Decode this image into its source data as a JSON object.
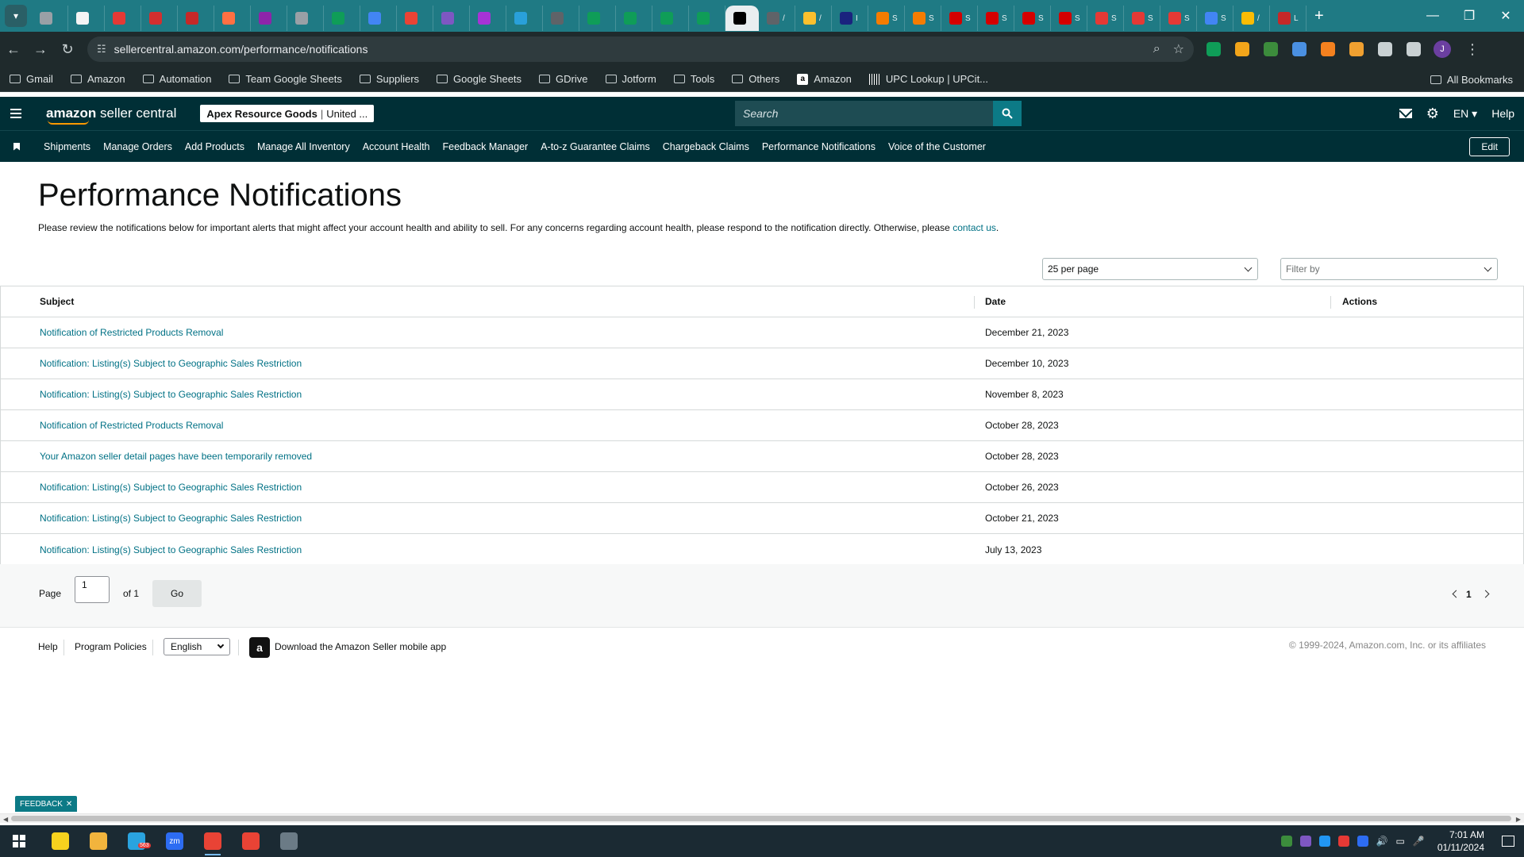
{
  "browser": {
    "tabs": [
      {
        "color": "#9aa0a6",
        "label": ""
      },
      {
        "color": "#f4f4f4",
        "label": ""
      },
      {
        "color": "#e53935",
        "label": ""
      },
      {
        "color": "#d32f2f",
        "label": ""
      },
      {
        "color": "#c62828",
        "label": ""
      },
      {
        "color": "#ff7043",
        "label": ""
      },
      {
        "color": "#8e24aa",
        "label": ""
      },
      {
        "color": "#9aa0a6",
        "label": ""
      },
      {
        "color": "#0f9d58",
        "label": ""
      },
      {
        "color": "#4285f4",
        "label": ""
      },
      {
        "color": "#ea4335",
        "label": ""
      },
      {
        "color": "#7e57c2",
        "label": ""
      },
      {
        "color": "#a633d6",
        "label": ""
      },
      {
        "color": "#29a0da",
        "label": ""
      },
      {
        "color": "#5f6368",
        "label": ""
      },
      {
        "color": "#0f9d58",
        "label": ""
      },
      {
        "color": "#0f9d58",
        "label": ""
      },
      {
        "color": "#0f9d58",
        "label": ""
      },
      {
        "color": "#0f9d58",
        "label": ""
      },
      {
        "color": "#000000",
        "label": "",
        "active": true
      },
      {
        "color": "#5f6368",
        "label": "/"
      },
      {
        "color": "#fbc02d",
        "label": "/"
      },
      {
        "color": "#1a237e",
        "label": "I"
      },
      {
        "color": "#f57c00",
        "label": "S"
      },
      {
        "color": "#f57c00",
        "label": "S"
      },
      {
        "color": "#d50000",
        "label": "S"
      },
      {
        "color": "#d50000",
        "label": "S"
      },
      {
        "color": "#d50000",
        "label": "S"
      },
      {
        "color": "#d50000",
        "label": "S"
      },
      {
        "color": "#e53935",
        "label": "S"
      },
      {
        "color": "#e53935",
        "label": "S"
      },
      {
        "color": "#e53935",
        "label": "S"
      },
      {
        "color": "#4285f4",
        "label": "S"
      },
      {
        "color": "#fbbc04",
        "label": "/"
      },
      {
        "color": "#c62828",
        "label": "L"
      }
    ],
    "new_tab_label": "+",
    "url": "sellercentral.amazon.com/performance/notifications",
    "bookmarks": [
      {
        "label": "Gmail",
        "type": "folder"
      },
      {
        "label": "Amazon",
        "type": "folder"
      },
      {
        "label": "Automation",
        "type": "folder"
      },
      {
        "label": "Team Google Sheets",
        "type": "folder"
      },
      {
        "label": "Suppliers",
        "type": "folder"
      },
      {
        "label": "Google Sheets",
        "type": "folder"
      },
      {
        "label": "GDrive",
        "type": "folder"
      },
      {
        "label": "Jotform",
        "type": "folder"
      },
      {
        "label": "Tools",
        "type": "folder"
      },
      {
        "label": "Others",
        "type": "folder"
      },
      {
        "label": "Amazon",
        "type": "amazon"
      },
      {
        "label": "UPC Lookup | UPCit...",
        "type": "upc"
      }
    ],
    "all_bookmarks": "All Bookmarks",
    "profile_initial": "J",
    "extensions": [
      "#0f9d58",
      "#f2a51a",
      "#3c8c3c",
      "#4a90e2",
      "#f4811f",
      "#f0a030",
      "#c9d1d3",
      "#c9d1d3"
    ]
  },
  "header": {
    "logo_brand": "amazon",
    "logo_product": " seller central",
    "store_name": "Apex Resource Goods",
    "store_separator": "|",
    "store_region": "United ...",
    "search_placeholder": "Search",
    "language": "EN",
    "help": "Help"
  },
  "nav": {
    "items": [
      "Shipments",
      "Manage Orders",
      "Add Products",
      "Manage All Inventory",
      "Account Health",
      "Feedback Manager",
      "A-to-z Guarantee Claims",
      "Chargeback Claims",
      "Performance Notifications",
      "Voice of the Customer"
    ],
    "edit": "Edit"
  },
  "page": {
    "title": "Performance Notifications",
    "description": "Please review the notifications below for important alerts that might affect your account health and ability to sell. For any concerns regarding account health, please respond to the notification directly. Otherwise, please ",
    "contact_link": "contact us",
    "description_end": ".",
    "per_page": "25 per page",
    "filter_placeholder": "Filter by"
  },
  "table": {
    "columns": [
      "Subject",
      "Date",
      "Actions"
    ],
    "rows": [
      {
        "subject": "Notification of Restricted Products Removal",
        "date": "December 21, 2023"
      },
      {
        "subject": "Notification: Listing(s) Subject to Geographic Sales Restriction",
        "date": "December 10, 2023"
      },
      {
        "subject": "Notification: Listing(s) Subject to Geographic Sales Restriction",
        "date": "November 8, 2023"
      },
      {
        "subject": "Notification of Restricted Products Removal",
        "date": "October 28, 2023"
      },
      {
        "subject": "Your Amazon seller detail pages have been temporarily removed",
        "date": "October 28, 2023"
      },
      {
        "subject": "Notification: Listing(s) Subject to Geographic Sales Restriction",
        "date": "October 26, 2023"
      },
      {
        "subject": "Notification: Listing(s) Subject to Geographic Sales Restriction",
        "date": "October 21, 2023"
      },
      {
        "subject": "Notification: Listing(s) Subject to Geographic Sales Restriction",
        "date": "July 13, 2023"
      }
    ]
  },
  "pagination": {
    "page_label": "Page",
    "page_value": "1",
    "of_label": "of 1",
    "go": "Go",
    "current": "1"
  },
  "footer": {
    "help": "Help",
    "program_policies": "Program Policies",
    "language": "English",
    "app_text": "Download the Amazon Seller mobile app",
    "copyright": "© 1999-2024, Amazon.com, Inc. or its affiliates"
  },
  "feedback": "FEEDBACK",
  "taskbar": {
    "apps": [
      {
        "name": "sticky-notes",
        "color": "#f7d21e"
      },
      {
        "name": "file-explorer",
        "color": "#f2b43d"
      },
      {
        "name": "telegram",
        "color": "#2aa3df",
        "badge": "563"
      },
      {
        "name": "zoom",
        "color": "#2d6cf2",
        "label": "zm"
      },
      {
        "name": "chrome",
        "color": "#e94335",
        "active": true
      },
      {
        "name": "chrome-profile",
        "color": "#e94335"
      },
      {
        "name": "calculator",
        "color": "#6b7b86"
      }
    ],
    "time": "7:01 AM",
    "date": "01/11/2024"
  }
}
